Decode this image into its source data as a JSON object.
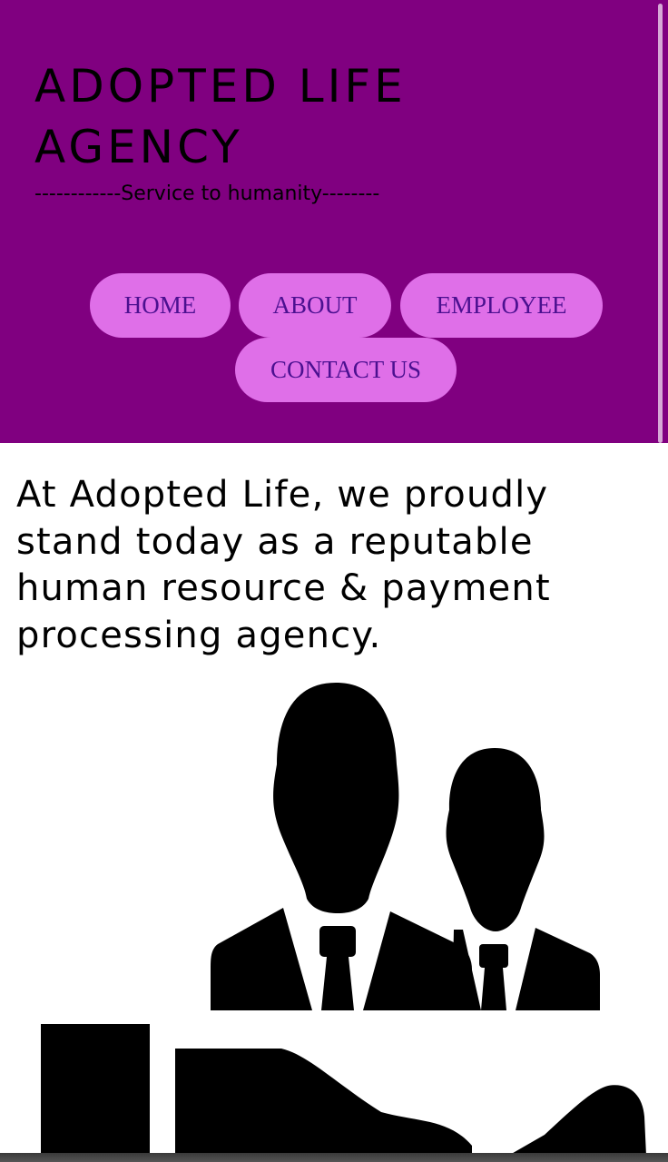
{
  "header": {
    "title": "ADOPTED LIFE AGENCY",
    "tagline": "------------Service to humanity--------",
    "background_color": "#800080",
    "button_color": "#df6fe8",
    "button_text_color": "#4b1090"
  },
  "nav": {
    "home": "HOME",
    "about": "ABOUT",
    "employee": "EMPLOYEE",
    "contact": "CONTACT US"
  },
  "main": {
    "intro": "At Adopted Life, we proudly stand today as a reputable human resource & payment processing agency.",
    "illustration_icon": "business-people-icon"
  }
}
